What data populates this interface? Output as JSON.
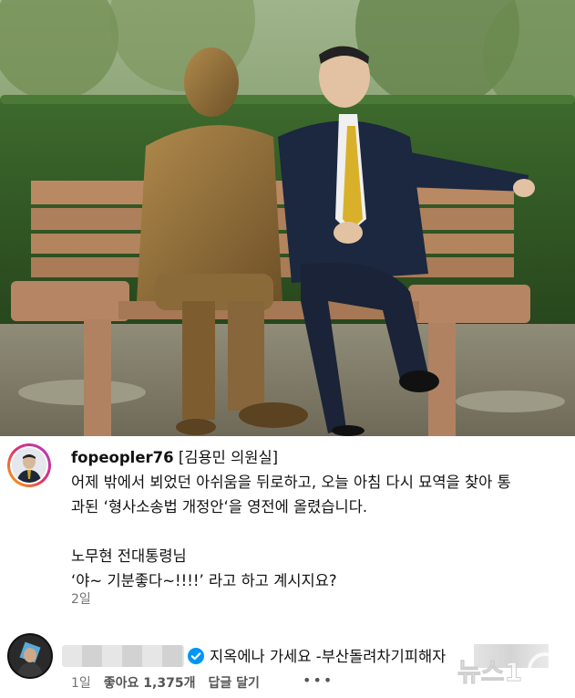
{
  "photo": {
    "alt_subject": "bronze-statue-and-man-on-bench"
  },
  "post": {
    "username": "fopeopler76",
    "lines": [
      "[김용민 의원실]",
      "어제 밖에서 뵈었던 아쉬움을 뒤로하고, 오늘 아침 다시 묘역을 찾아 통",
      "과된 ‘형사소송법 개정안‘을 영전에 올렸습니다.",
      "",
      "노무현 전대통령님",
      "‘야~ 기분좋다~!!!!’ 라고 하고 계시지요?"
    ],
    "time": "2일"
  },
  "comment": {
    "text": "지옥에나 가세요 -부산돌려차기피해자 ",
    "time": "1일",
    "likes": "좋아요 1,375개",
    "reply": "답글 달기",
    "more": "•••"
  },
  "watermark": {
    "text": "뉴스1"
  },
  "colors": {
    "verified": "#0095f6",
    "muted": "#737373"
  }
}
